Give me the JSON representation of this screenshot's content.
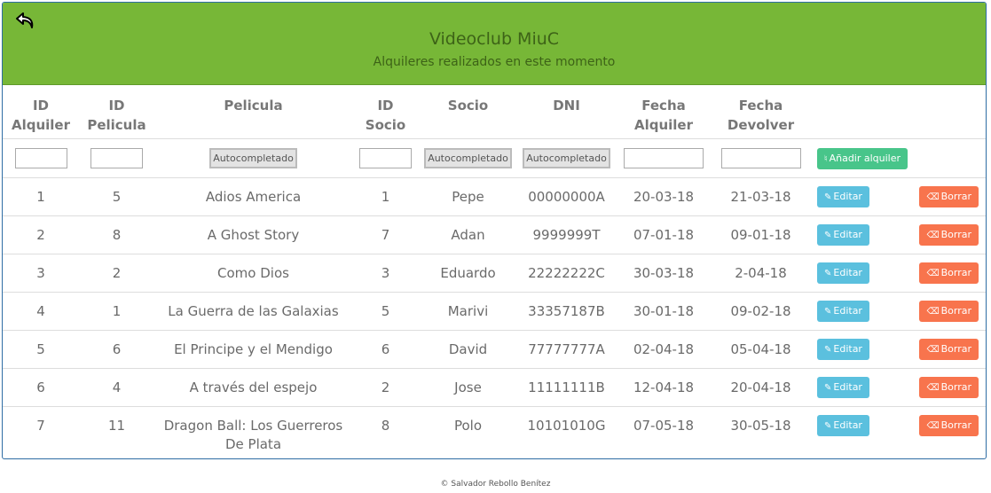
{
  "header": {
    "title": "Videoclub MiuC",
    "subtitle": "Alquileres realizados en este momento",
    "back_icon": "back-arrow-icon",
    "color": "#77b737"
  },
  "table": {
    "columns": [
      {
        "line1": "ID",
        "line2": "Alquiler"
      },
      {
        "line1": "ID",
        "line2": "Pelicula"
      },
      {
        "line1": "Pelicula",
        "line2": ""
      },
      {
        "line1": "ID",
        "line2": "Socio"
      },
      {
        "line1": "Socio",
        "line2": ""
      },
      {
        "line1": "DNI",
        "line2": ""
      },
      {
        "line1": "Fecha",
        "line2": "Alquiler"
      },
      {
        "line1": "Fecha",
        "line2": "Devolver"
      }
    ],
    "filters": {
      "id_alquiler": "",
      "id_pelicula": "",
      "pelicula_placeholder": "Autocompletado",
      "id_socio": "",
      "socio_placeholder": "Autocompletado",
      "dni_placeholder": "Autocompletado",
      "fecha_alquiler": "",
      "fecha_devolver": "",
      "add_label": "Añadir alquiler"
    },
    "rows": [
      {
        "id_alquiler": "1",
        "id_pelicula": "5",
        "pelicula": "Adios America",
        "id_socio": "1",
        "socio": "Pepe",
        "dni": "00000000A",
        "fecha_alquiler": "20-03-18",
        "fecha_devolver": "21-03-18"
      },
      {
        "id_alquiler": "2",
        "id_pelicula": "8",
        "pelicula": "A Ghost Story",
        "id_socio": "7",
        "socio": "Adan",
        "dni": "9999999T",
        "fecha_alquiler": "07-01-18",
        "fecha_devolver": "09-01-18"
      },
      {
        "id_alquiler": "3",
        "id_pelicula": "2",
        "pelicula": "Como Dios",
        "id_socio": "3",
        "socio": "Eduardo",
        "dni": "22222222C",
        "fecha_alquiler": "30-03-18",
        "fecha_devolver": "2-04-18"
      },
      {
        "id_alquiler": "4",
        "id_pelicula": "1",
        "pelicula": "La Guerra de las Galaxias",
        "id_socio": "5",
        "socio": "Marivi",
        "dni": "33357187B",
        "fecha_alquiler": "30-01-18",
        "fecha_devolver": "09-02-18"
      },
      {
        "id_alquiler": "5",
        "id_pelicula": "6",
        "pelicula": "El Principe y el Mendigo",
        "id_socio": "6",
        "socio": "David",
        "dni": "77777777A",
        "fecha_alquiler": "02-04-18",
        "fecha_devolver": "05-04-18"
      },
      {
        "id_alquiler": "6",
        "id_pelicula": "4",
        "pelicula": "A través del espejo",
        "id_socio": "2",
        "socio": "Jose",
        "dni": "11111111B",
        "fecha_alquiler": "12-04-18",
        "fecha_devolver": "20-04-18"
      },
      {
        "id_alquiler": "7",
        "id_pelicula": "11",
        "pelicula": "Dragon Ball: Los Guerreros De Plata",
        "id_socio": "8",
        "socio": "Polo",
        "dni": "10101010G",
        "fecha_alquiler": "07-05-18",
        "fecha_devolver": "30-05-18"
      }
    ],
    "edit_label": "Editar",
    "delete_label": "Borrar",
    "edit_icon": "edit-icon",
    "delete_icon": "eraser-icon",
    "add_icon": "add-rental-icon"
  },
  "colors": {
    "add": "#48c58a",
    "edit": "#5bc0de",
    "delete": "#f8744d"
  },
  "footer": {
    "text": "© Salvador Rebollo Benítez"
  }
}
